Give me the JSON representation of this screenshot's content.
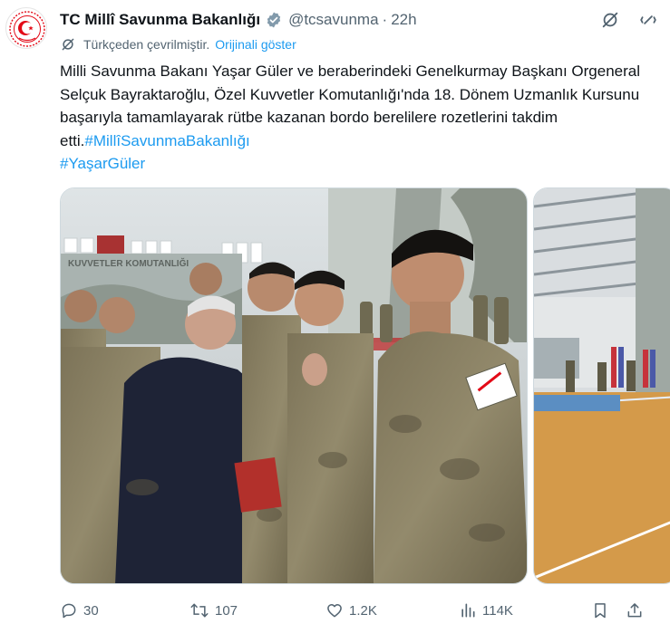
{
  "author": {
    "name": "TC Millî Savunma Bakanlığı",
    "handle": "@tcsavunma",
    "separator": "·",
    "time": "22h"
  },
  "translation": {
    "note": "Türkçeden çevrilmiştir.",
    "show_original": "Orijinali göster"
  },
  "tweet": {
    "text": "Milli Savunma Bakanı Yaşar Güler ve beraberindeki Genelkurmay Başkanı Orgeneral Selçuk Bayraktaroğlu, Özel Kuvvetler Komutanlığı'nda 18. Dönem Uzmanlık Kursunu başarıyla tamamlayarak rütbe kazanan bordo berelilere rozetlerini takdim etti.",
    "hashtags": [
      "#MillîSavunmaBakanlığı",
      "#YaşarGüler"
    ]
  },
  "media": {
    "banner_text": "KUVVETLER KOMUTANLIĞI"
  },
  "actions": {
    "replies": "30",
    "reposts": "107",
    "likes": "1.2K",
    "views": "114K"
  },
  "icons": [
    "verified-badge-icon",
    "translate-toggle-icon",
    "more-icon",
    "translate-icon",
    "reply-icon",
    "repost-icon",
    "like-icon",
    "views-icon",
    "bookmark-icon",
    "share-icon"
  ],
  "colors": {
    "accent": "#1d9bf0",
    "secondary_text": "#536471",
    "logo_red": "#e30a17"
  }
}
